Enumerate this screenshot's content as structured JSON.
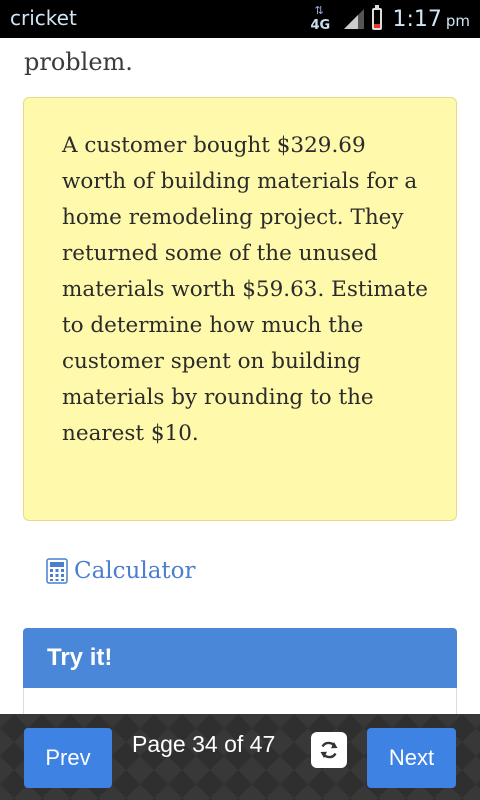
{
  "status_bar": {
    "carrier": "cricket",
    "network": "4G",
    "time": "1:17",
    "ampm": "pm"
  },
  "content": {
    "previous_text_clipped": "problem.",
    "problem_text": "A customer bought $329.69 worth of building materials for a home remodeling project. They returned some of the unused materials worth $59.63. Estimate to determine how much the customer spent on building materials by rounding to the nearest $10.",
    "calculator_label": "Calculator",
    "try_it_label": "Try it!"
  },
  "navigation": {
    "prev_label": "Prev",
    "page_indicator": "Page 34 of 47",
    "next_label": "Next"
  },
  "colors": {
    "problem_bg": "#fff9ab",
    "link": "#4a7fd0",
    "accent": "#3e82e4",
    "tryit_header": "#4a87d8",
    "status_bar": "#000000"
  },
  "icons": {
    "calculator": "calculator-icon",
    "refresh": "refresh-icon",
    "signal": "signal-icon",
    "battery": "battery-icon"
  }
}
